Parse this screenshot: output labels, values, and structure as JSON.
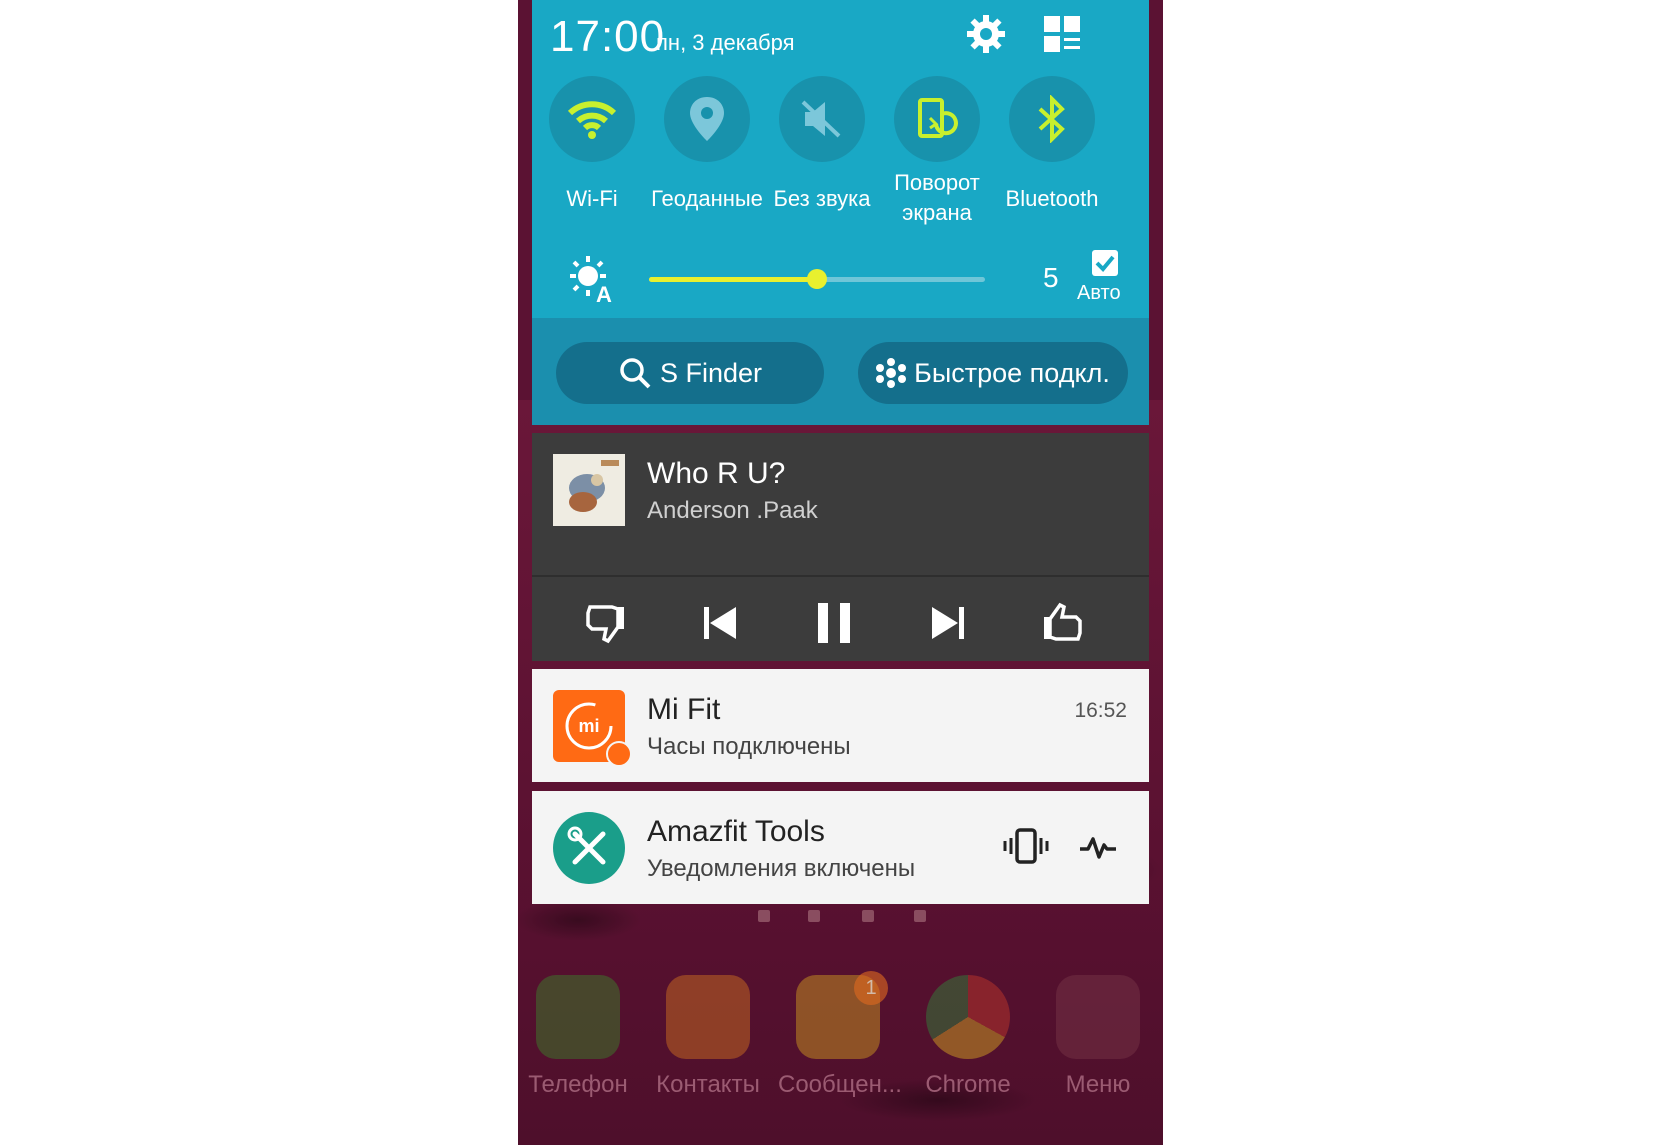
{
  "status": {
    "time": "17:00",
    "date": "пн, 3 декабря"
  },
  "toggles": [
    {
      "label": "Wi-Fi",
      "icon": "wifi-icon",
      "active": true
    },
    {
      "label": "Геоданные",
      "icon": "location-icon",
      "active": false
    },
    {
      "label": "Без звука",
      "icon": "mute-icon",
      "active": false
    },
    {
      "label": "Поворот экрана",
      "icon": "rotate-icon",
      "active": true
    },
    {
      "label": "Bluetooth",
      "icon": "bluetooth-icon",
      "active": true
    }
  ],
  "brightness": {
    "value": "5",
    "level": 0.5,
    "auto_label": "Авто",
    "auto_checked": true
  },
  "actions": {
    "finder": "S Finder",
    "quick_connect": "Быстрое подкл."
  },
  "music": {
    "title": "Who R U?",
    "artist": "Anderson .Paak"
  },
  "notifications": {
    "mifit": {
      "title": "Mi Fit",
      "text": "Часы подключены",
      "time": "16:52"
    },
    "amazfit": {
      "title": "Amazfit Tools",
      "text": "Уведомления включены"
    }
  },
  "dock": [
    {
      "label": "Телефон",
      "icon": "phone-icon"
    },
    {
      "label": "Контакты",
      "icon": "contacts-icon"
    },
    {
      "label": "Сообщен...",
      "icon": "messages-icon",
      "badge": "1"
    },
    {
      "label": "Chrome",
      "icon": "chrome-icon"
    },
    {
      "label": "Меню",
      "icon": "apps-menu-icon"
    }
  ],
  "colors": {
    "panel": "#19a8c5",
    "accent": "#c8f02e",
    "mifit": "#ff6a14",
    "amazfit": "#1a9e8a"
  }
}
